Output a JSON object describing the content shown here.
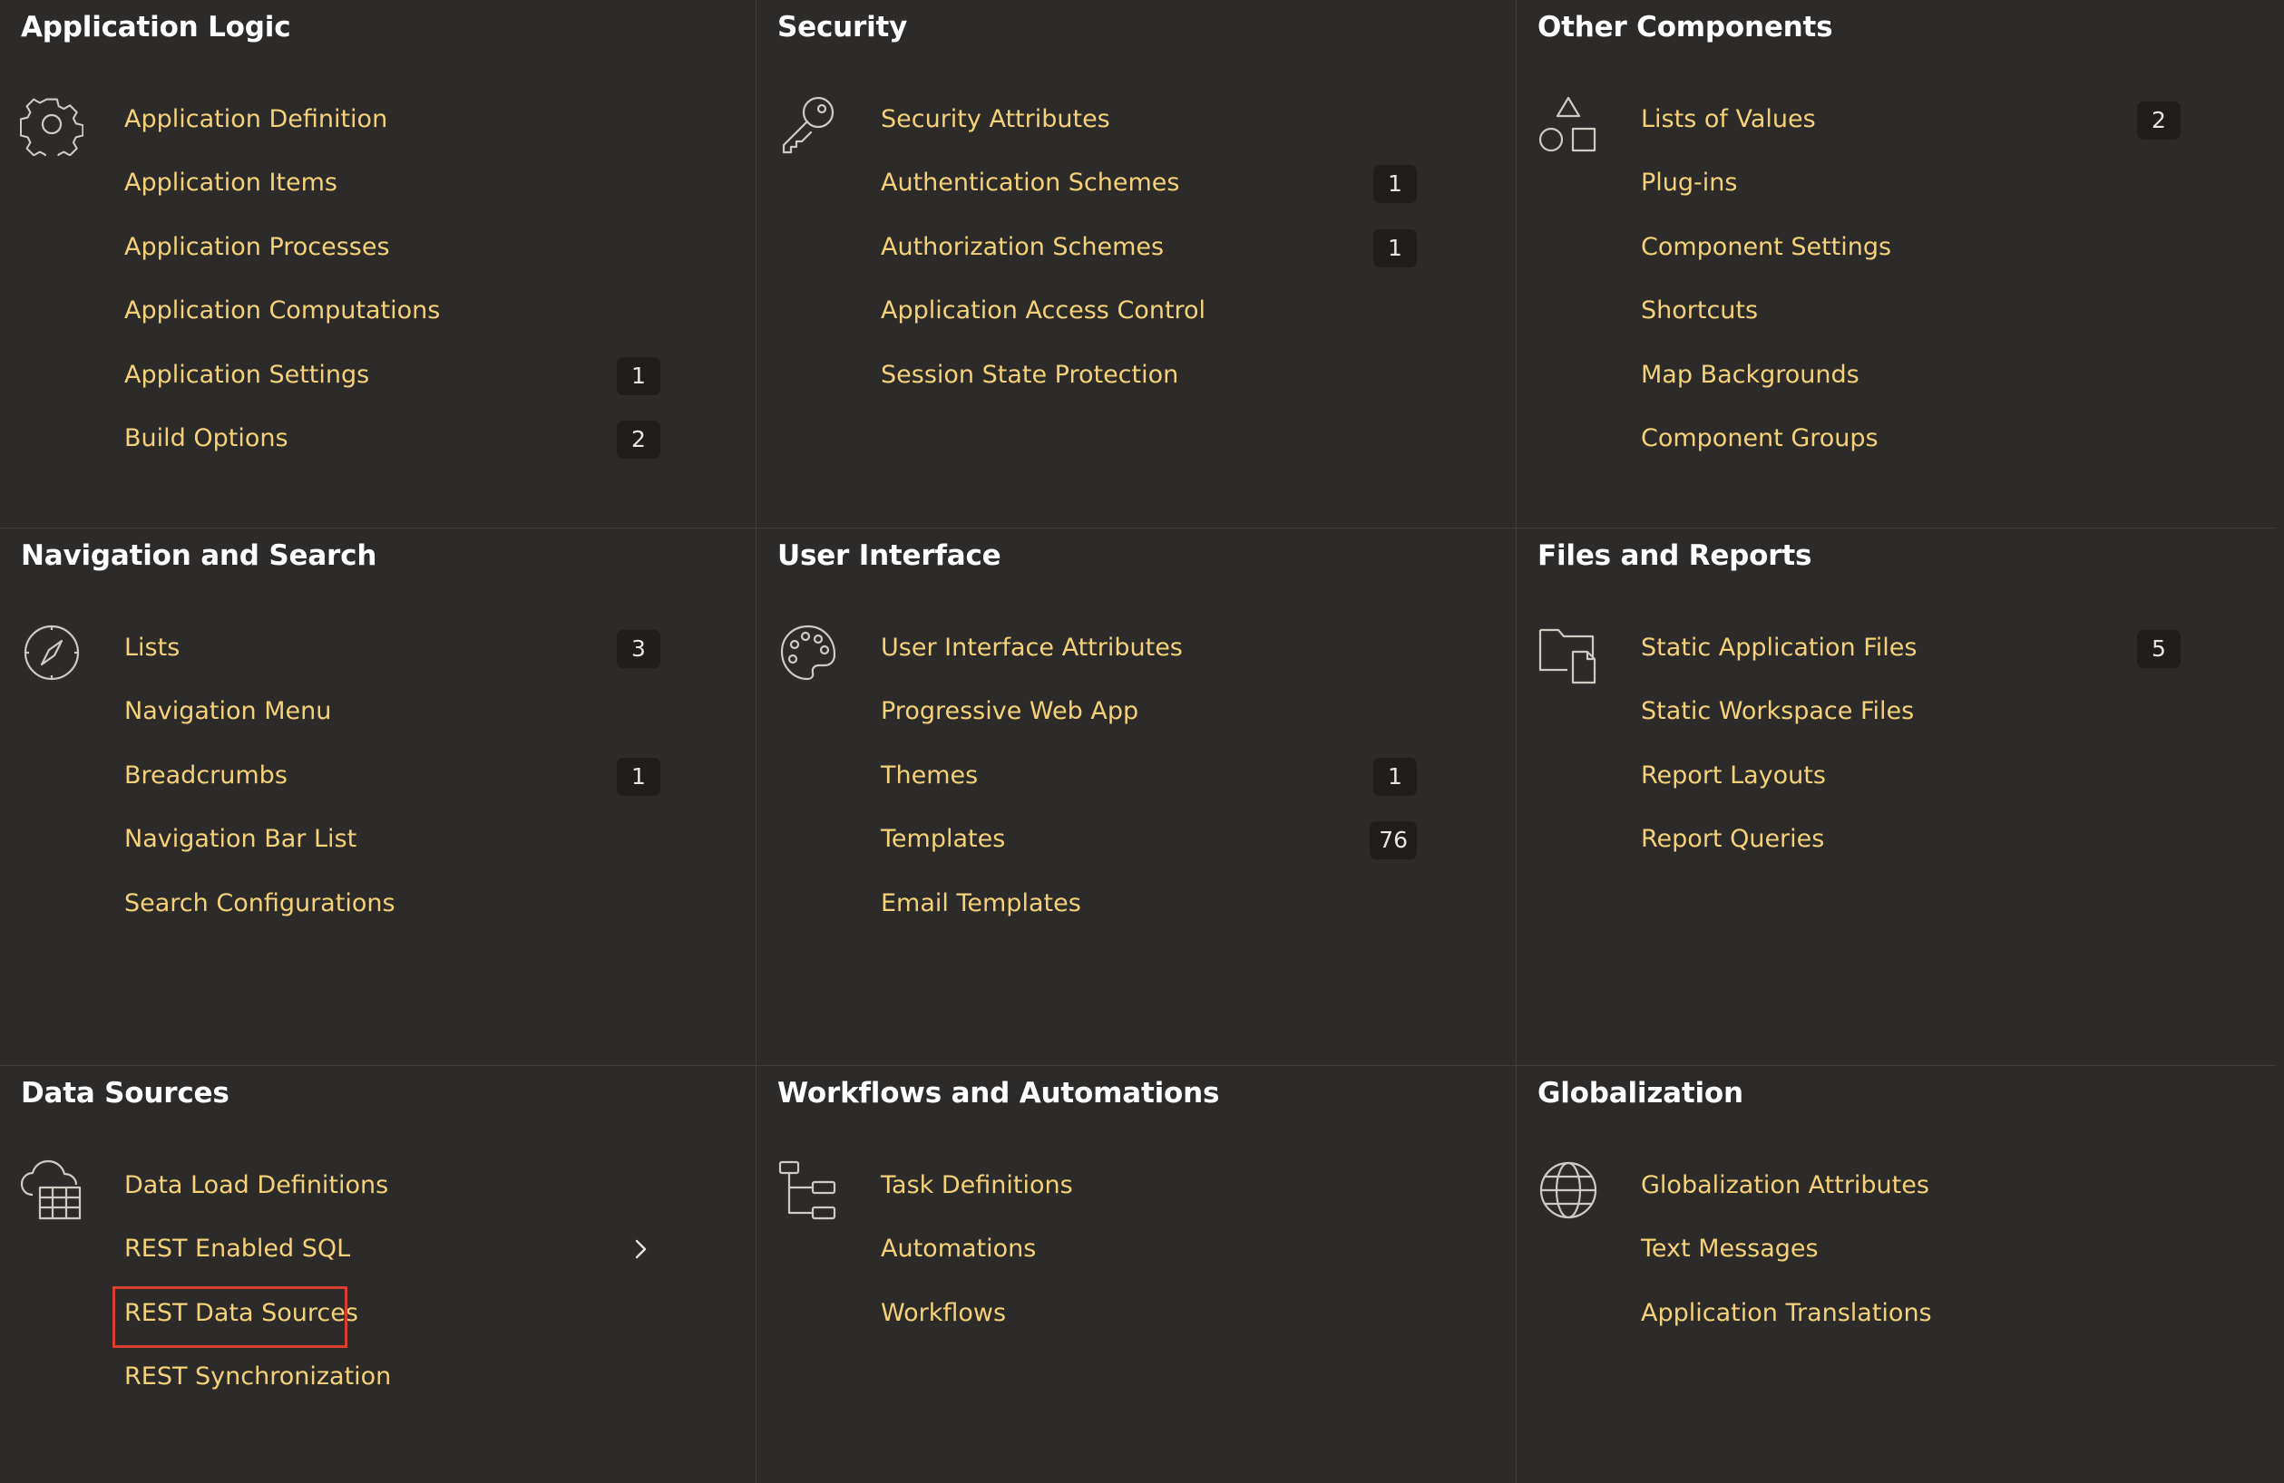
{
  "panels": [
    {
      "title": "Application Logic",
      "icon": "gear-icon",
      "items": [
        {
          "label": "Application Definition",
          "badge": ""
        },
        {
          "label": "Application Items",
          "badge": ""
        },
        {
          "label": "Application Processes",
          "badge": ""
        },
        {
          "label": "Application Computations",
          "badge": ""
        },
        {
          "label": "Application Settings",
          "badge": "1"
        },
        {
          "label": "Build Options",
          "badge": "2"
        }
      ]
    },
    {
      "title": "Security",
      "icon": "key-icon",
      "items": [
        {
          "label": "Security Attributes",
          "badge": ""
        },
        {
          "label": "Authentication Schemes",
          "badge": "1"
        },
        {
          "label": "Authorization Schemes",
          "badge": "1"
        },
        {
          "label": "Application Access Control",
          "badge": ""
        },
        {
          "label": "Session State Protection",
          "badge": ""
        }
      ]
    },
    {
      "title": "Other Components",
      "icon": "shapes-icon",
      "items": [
        {
          "label": "Lists of Values",
          "badge": "2"
        },
        {
          "label": "Plug-ins",
          "badge": ""
        },
        {
          "label": "Component Settings",
          "badge": ""
        },
        {
          "label": "Shortcuts",
          "badge": ""
        },
        {
          "label": "Map Backgrounds",
          "badge": ""
        },
        {
          "label": "Component Groups",
          "badge": ""
        }
      ]
    },
    {
      "title": "Navigation and Search",
      "icon": "compass-icon",
      "items": [
        {
          "label": "Lists",
          "badge": "3"
        },
        {
          "label": "Navigation Menu",
          "badge": ""
        },
        {
          "label": "Breadcrumbs",
          "badge": "1"
        },
        {
          "label": "Navigation Bar List",
          "badge": ""
        },
        {
          "label": "Search Configurations",
          "badge": ""
        }
      ]
    },
    {
      "title": "User Interface",
      "icon": "palette-icon",
      "items": [
        {
          "label": "User Interface Attributes",
          "badge": ""
        },
        {
          "label": "Progressive Web App",
          "badge": ""
        },
        {
          "label": "Themes",
          "badge": "1"
        },
        {
          "label": "Templates",
          "badge": "76"
        },
        {
          "label": "Email Templates",
          "badge": ""
        }
      ]
    },
    {
      "title": "Files and Reports",
      "icon": "folder-file-icon",
      "items": [
        {
          "label": "Static Application Files",
          "badge": "5"
        },
        {
          "label": "Static Workspace Files",
          "badge": ""
        },
        {
          "label": "Report Layouts",
          "badge": ""
        },
        {
          "label": "Report Queries",
          "badge": ""
        }
      ]
    },
    {
      "title": "Data Sources",
      "icon": "cloud-table-icon",
      "items": [
        {
          "label": "Data Load Definitions",
          "badge": ""
        },
        {
          "label": "REST Enabled SQL",
          "badge": "",
          "chevron": "chevron-right-icon"
        },
        {
          "label": "REST Data Sources",
          "badge": "",
          "highlighted": true
        },
        {
          "label": "REST Synchronization",
          "badge": ""
        }
      ]
    },
    {
      "title": "Workflows and Automations",
      "icon": "workflow-tree-icon",
      "items": [
        {
          "label": "Task Definitions",
          "badge": ""
        },
        {
          "label": "Automations",
          "badge": ""
        },
        {
          "label": "Workflows",
          "badge": ""
        }
      ]
    },
    {
      "title": "Globalization",
      "icon": "globe-icon",
      "items": [
        {
          "label": "Globalization Attributes",
          "badge": ""
        },
        {
          "label": "Text Messages",
          "badge": ""
        },
        {
          "label": "Application Translations",
          "badge": ""
        }
      ]
    }
  ],
  "colors": {
    "background": "#2d2b29",
    "divider": "#403e3c",
    "link": "#f5d27a",
    "title": "#ffffff",
    "badge_bg": "#1f1e1c",
    "highlight": "#d8402d",
    "icon_stroke": "#cfcac4"
  }
}
